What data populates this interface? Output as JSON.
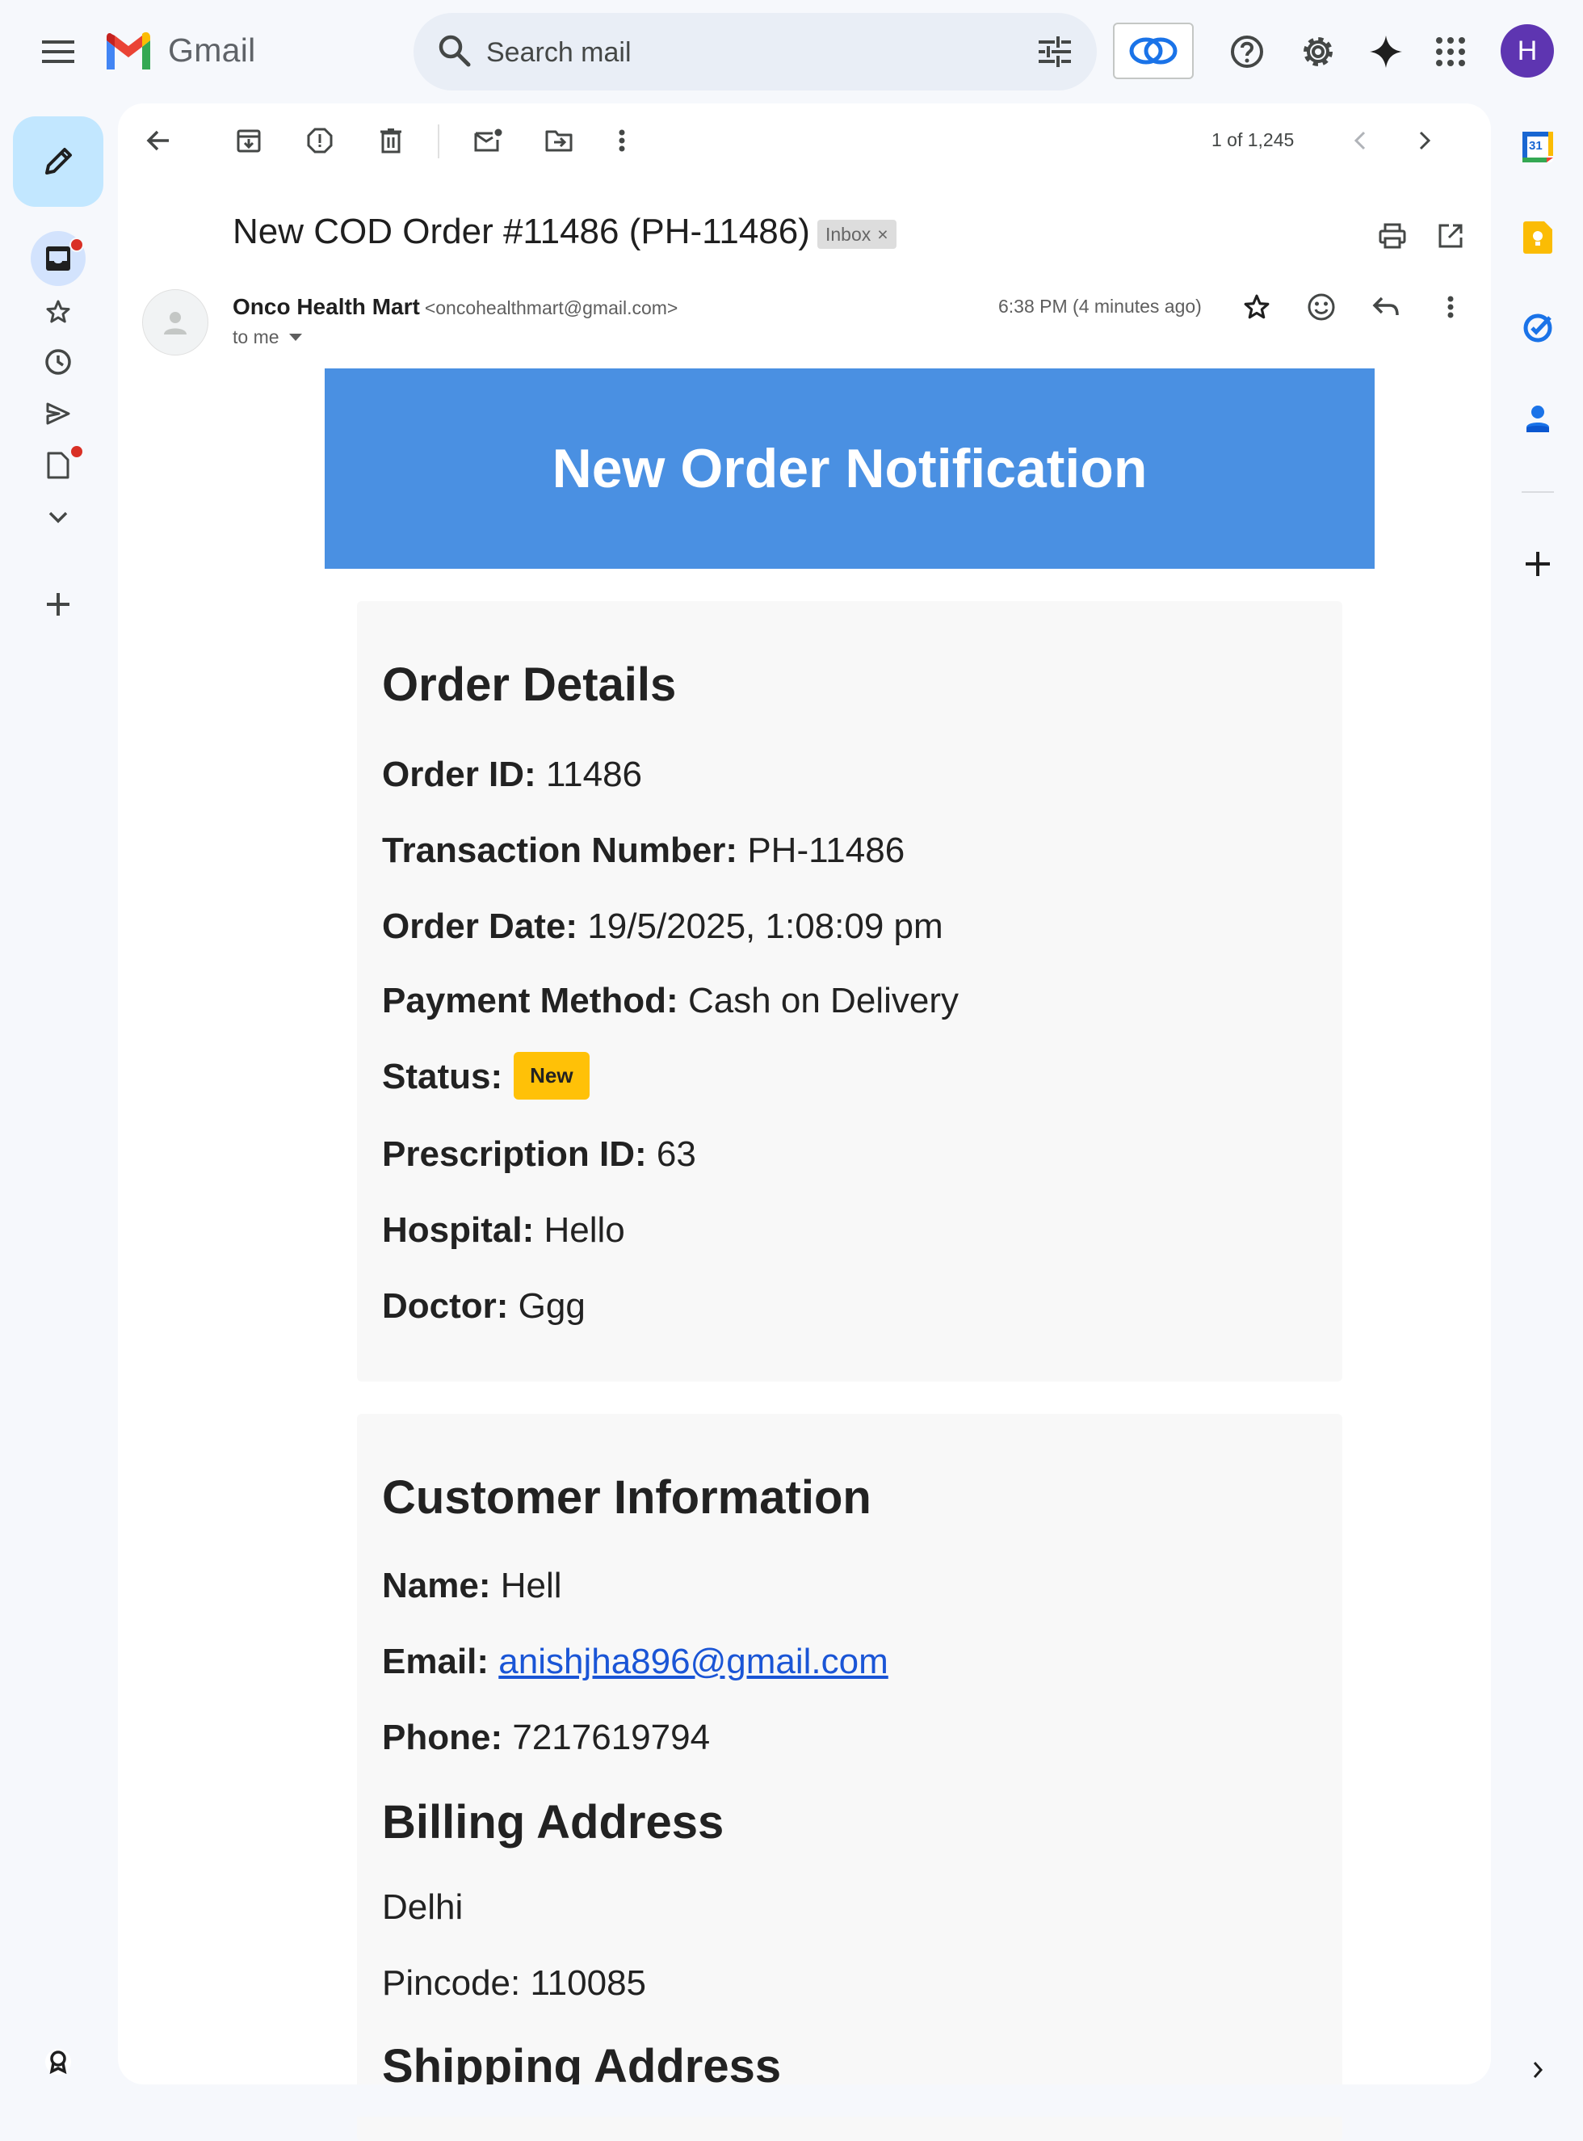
{
  "app": {
    "name": "Gmail"
  },
  "search": {
    "placeholder": "Search mail"
  },
  "user": {
    "avatar_initial": "H",
    "avatar_color": "#5e35b1"
  },
  "toolbar": {
    "pager": "1 of 1,245"
  },
  "email": {
    "subject": "New COD Order #11486 (PH-11486)",
    "label_chip": "Inbox",
    "label_chip_close": "×",
    "sender_name": "Onco Health Mart",
    "sender_email": "<oncohealthmart@gmail.com>",
    "recipient": "to me",
    "time": "6:38 PM (4 minutes ago)"
  },
  "body": {
    "banner_title": "New Order Notification",
    "banner_color": "#4a90e2",
    "order_details": {
      "heading": "Order Details",
      "order_id_label": "Order ID:",
      "order_id": "11486",
      "transaction_label": "Transaction Number:",
      "transaction": "PH-11486",
      "date_label": "Order Date:",
      "date": "19/5/2025, 1:08:09 pm",
      "payment_label": "Payment Method:",
      "payment": "Cash on Delivery",
      "status_label": "Status:",
      "status": "New",
      "status_color": "#ffc107",
      "prescription_label": "Prescription ID:",
      "prescription": "63",
      "hospital_label": "Hospital:",
      "hospital": "Hello",
      "doctor_label": "Doctor:",
      "doctor": "Ggg"
    },
    "customer": {
      "heading": "Customer Information",
      "name_label": "Name:",
      "name": "Hell",
      "email_label": "Email:",
      "email": "anishjha896@gmail.com",
      "phone_label": "Phone:",
      "phone": "7217619794"
    },
    "billing": {
      "heading": "Billing Address",
      "city": "Delhi",
      "pincode": "Pincode: 110085"
    },
    "shipping": {
      "heading": "Shipping Address"
    }
  },
  "side_apps": {
    "calendar_day": "31"
  }
}
